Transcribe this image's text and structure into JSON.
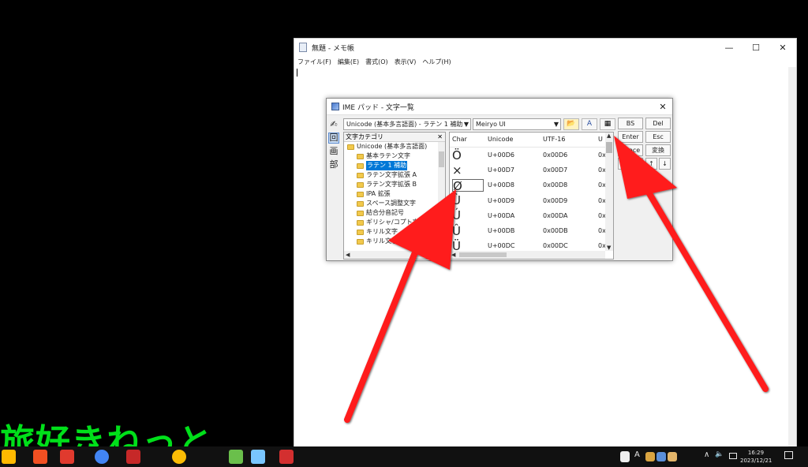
{
  "notepad": {
    "title": "無題 - メモ帳",
    "menu": [
      "ファイル(F)",
      "編集(E)",
      "書式(O)",
      "表示(V)",
      "ヘルプ(H)"
    ],
    "controls": {
      "minimize": "—",
      "maximize": "☐",
      "close": "✕"
    }
  },
  "ime": {
    "title": "IME パッド - 文字一覧",
    "close": "✕",
    "side_icons": [
      "✍",
      "回",
      "画",
      "部"
    ],
    "charset_select": "Unicode (基本多言語面) - ラテン 1 補助",
    "font_select": "Meiryo UI",
    "category": {
      "header": "文字カテゴリ",
      "close": "✕",
      "items": [
        {
          "label": "Unicode (基本多言語面)",
          "indent": 0,
          "selected": false
        },
        {
          "label": "基本ラテン文字",
          "indent": 1,
          "selected": false
        },
        {
          "label": "ラテン 1 補助",
          "indent": 1,
          "selected": true
        },
        {
          "label": "ラテン文字拡張 A",
          "indent": 1,
          "selected": false
        },
        {
          "label": "ラテン文字拡張 B",
          "indent": 1,
          "selected": false
        },
        {
          "label": "IPA 拡張",
          "indent": 1,
          "selected": false
        },
        {
          "label": "スペース調整文字",
          "indent": 1,
          "selected": false
        },
        {
          "label": "結合分音記号",
          "indent": 1,
          "selected": false
        },
        {
          "label": "ギリシャ/コプト文字",
          "indent": 1,
          "selected": false
        },
        {
          "label": "キリル文字",
          "indent": 1,
          "selected": false
        },
        {
          "label": "キリル文字補助",
          "indent": 1,
          "selected": false
        }
      ]
    },
    "grid": {
      "columns": [
        "Char",
        "Unicode",
        "UTF-16",
        "U"
      ],
      "rows": [
        {
          "char": "Ö",
          "unicode": "U+00D6",
          "utf16": "0x00D6",
          "more": "0x"
        },
        {
          "char": "×",
          "unicode": "U+00D7",
          "utf16": "0x00D7",
          "more": "0x"
        },
        {
          "char": "Ø",
          "unicode": "U+00D8",
          "utf16": "0x00D8",
          "more": "0x"
        },
        {
          "char": "Ù",
          "unicode": "U+00D9",
          "utf16": "0x00D9",
          "more": "0x"
        },
        {
          "char": "Ú",
          "unicode": "U+00DA",
          "utf16": "0x00DA",
          "more": "0x"
        },
        {
          "char": "Û",
          "unicode": "U+00DB",
          "utf16": "0x00DB",
          "more": "0x"
        },
        {
          "char": "Ü",
          "unicode": "U+00DC",
          "utf16": "0x00DC",
          "more": "0x"
        }
      ]
    },
    "keys": {
      "bs": "BS",
      "del": "Del",
      "enter": "Enter",
      "esc": "Esc",
      "space": "Space",
      "convert": "変換",
      "left": "←",
      "right": "→",
      "up": "↑",
      "down": "↓"
    }
  },
  "watermark": "旅好きねっと",
  "taskbar": {
    "tray": [
      "∧",
      "🔈",
      "A"
    ],
    "time": "16:29",
    "date": "2023/12/21"
  },
  "colors": {
    "arrow": "#ff1a1a",
    "watermark": "#00e01a",
    "selection": "#0078d7"
  }
}
